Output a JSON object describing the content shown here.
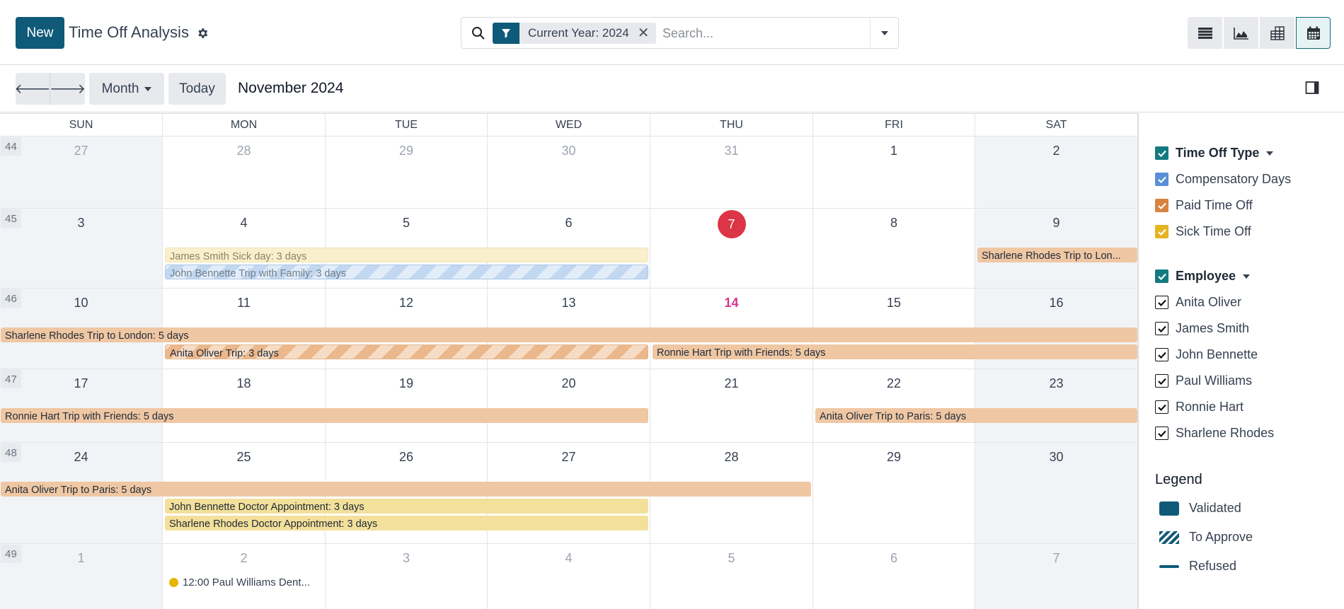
{
  "control_panel": {
    "new_label": "New",
    "title": "Time Off Analysis",
    "search": {
      "facet_label": "Current Year: 2024",
      "placeholder": "Search..."
    },
    "views": [
      "list-view",
      "graph-view",
      "pivot-view",
      "calendar-view"
    ],
    "active_view": "calendar-view"
  },
  "toolbar": {
    "scale_label": "Month",
    "today_label": "Today",
    "period": "November 2024"
  },
  "calendar": {
    "weekdays": [
      "SUN",
      "MON",
      "TUE",
      "WED",
      "THU",
      "FRI",
      "SAT"
    ],
    "weeks": [
      {
        "number": "44",
        "days": [
          {
            "d": "27",
            "other": true
          },
          {
            "d": "28",
            "other": true
          },
          {
            "d": "29",
            "other": true
          },
          {
            "d": "30",
            "other": true
          },
          {
            "d": "31",
            "other": true
          },
          {
            "d": "1"
          },
          {
            "d": "2"
          }
        ]
      },
      {
        "number": "45",
        "days": [
          {
            "d": "3"
          },
          {
            "d": "4"
          },
          {
            "d": "5"
          },
          {
            "d": "6"
          },
          {
            "d": "7",
            "today": true
          },
          {
            "d": "8"
          },
          {
            "d": "9"
          }
        ]
      },
      {
        "number": "46",
        "days": [
          {
            "d": "10"
          },
          {
            "d": "11"
          },
          {
            "d": "12"
          },
          {
            "d": "13"
          },
          {
            "d": "14",
            "highlight": true
          },
          {
            "d": "15"
          },
          {
            "d": "16"
          }
        ]
      },
      {
        "number": "47",
        "days": [
          {
            "d": "17"
          },
          {
            "d": "18"
          },
          {
            "d": "19"
          },
          {
            "d": "20"
          },
          {
            "d": "21"
          },
          {
            "d": "22"
          },
          {
            "d": "23"
          }
        ]
      },
      {
        "number": "48",
        "days": [
          {
            "d": "24"
          },
          {
            "d": "25"
          },
          {
            "d": "26"
          },
          {
            "d": "27"
          },
          {
            "d": "28"
          },
          {
            "d": "29"
          },
          {
            "d": "30"
          }
        ]
      },
      {
        "number": "49",
        "days": [
          {
            "d": "1",
            "other": true
          },
          {
            "d": "2",
            "other": true
          },
          {
            "d": "3",
            "other": true
          },
          {
            "d": "4",
            "other": true
          },
          {
            "d": "5",
            "other": true
          },
          {
            "d": "6",
            "other": true
          },
          {
            "d": "7",
            "other": true
          }
        ]
      }
    ],
    "events": [
      {
        "label": "James Smith Sick day: 3 days",
        "week": 1,
        "start": 1,
        "span": 3,
        "row": 0,
        "type": "sick",
        "state": "faded"
      },
      {
        "label": "John Bennette Trip with Family: 3 days",
        "week": 1,
        "start": 1,
        "span": 3,
        "row": 1,
        "type": "comp",
        "state": "approve"
      },
      {
        "label": "Sharlene Rhodes Trip to Lon...",
        "week": 1,
        "start": 6,
        "span": 1,
        "row": 0,
        "type": "pto",
        "state": "validated"
      },
      {
        "label": "Sharlene Rhodes Trip to London: 5 days",
        "week": 2,
        "start": 0,
        "span": 7,
        "row": 0,
        "type": "pto",
        "state": "validated"
      },
      {
        "label": "Anita Oliver Trip: 3 days",
        "week": 2,
        "start": 1,
        "span": 3,
        "row": 1,
        "type": "pto",
        "state": "approve"
      },
      {
        "label": "Ronnie Hart Trip with Friends: 5 days",
        "week": 2,
        "start": 4,
        "span": 3,
        "row": 1,
        "type": "pto",
        "state": "validated"
      },
      {
        "label": "Ronnie Hart Trip with Friends: 5 days",
        "week": 3,
        "start": 0,
        "span": 4,
        "row": 0,
        "type": "pto",
        "state": "validated"
      },
      {
        "label": "Anita Oliver Trip to Paris: 5 days",
        "week": 3,
        "start": 5,
        "span": 2,
        "row": 0,
        "type": "pto",
        "state": "validated"
      },
      {
        "label": "Anita Oliver Trip to Paris: 5 days",
        "week": 4,
        "start": 0,
        "span": 5,
        "row": 0,
        "type": "pto",
        "state": "validated"
      },
      {
        "label": "John Bennette Doctor Appointment: 3 days",
        "week": 4,
        "start": 1,
        "span": 3,
        "row": 1,
        "type": "sick",
        "state": "validated"
      },
      {
        "label": "Sharlene Rhodes Doctor Appointment: 3 days",
        "week": 4,
        "start": 1,
        "span": 3,
        "row": 2,
        "type": "sick",
        "state": "validated"
      }
    ],
    "timed_events": [
      {
        "label": "12:00 Paul Williams Dent...",
        "week": 5,
        "day": 1,
        "color": "#e5b600"
      }
    ]
  },
  "side_panel": {
    "time_off_type": {
      "title": "Time Off Type",
      "items": [
        {
          "label": "Compensatory Days",
          "color": "#5b8fd6",
          "checked": true
        },
        {
          "label": "Paid Time Off",
          "color": "#d9833f",
          "checked": true
        },
        {
          "label": "Sick Time Off",
          "color": "#e6b422",
          "checked": true
        }
      ]
    },
    "employee": {
      "title": "Employee",
      "items": [
        {
          "label": "Anita Oliver",
          "checked": true
        },
        {
          "label": "James Smith",
          "checked": true
        },
        {
          "label": "John Bennette",
          "checked": true
        },
        {
          "label": "Paul Williams",
          "checked": true
        },
        {
          "label": "Ronnie Hart",
          "checked": true
        },
        {
          "label": "Sharlene Rhodes",
          "checked": true
        }
      ]
    },
    "legend": {
      "title": "Legend",
      "items": [
        {
          "label": "Validated",
          "style": "validated"
        },
        {
          "label": "To Approve",
          "style": "approve"
        },
        {
          "label": "Refused",
          "style": "refused"
        }
      ]
    }
  },
  "colors": {
    "brand": "#0f5a78",
    "today": "#dc3545",
    "highlight_day": "#d6338d",
    "group_checkbox": "#137a7f"
  }
}
